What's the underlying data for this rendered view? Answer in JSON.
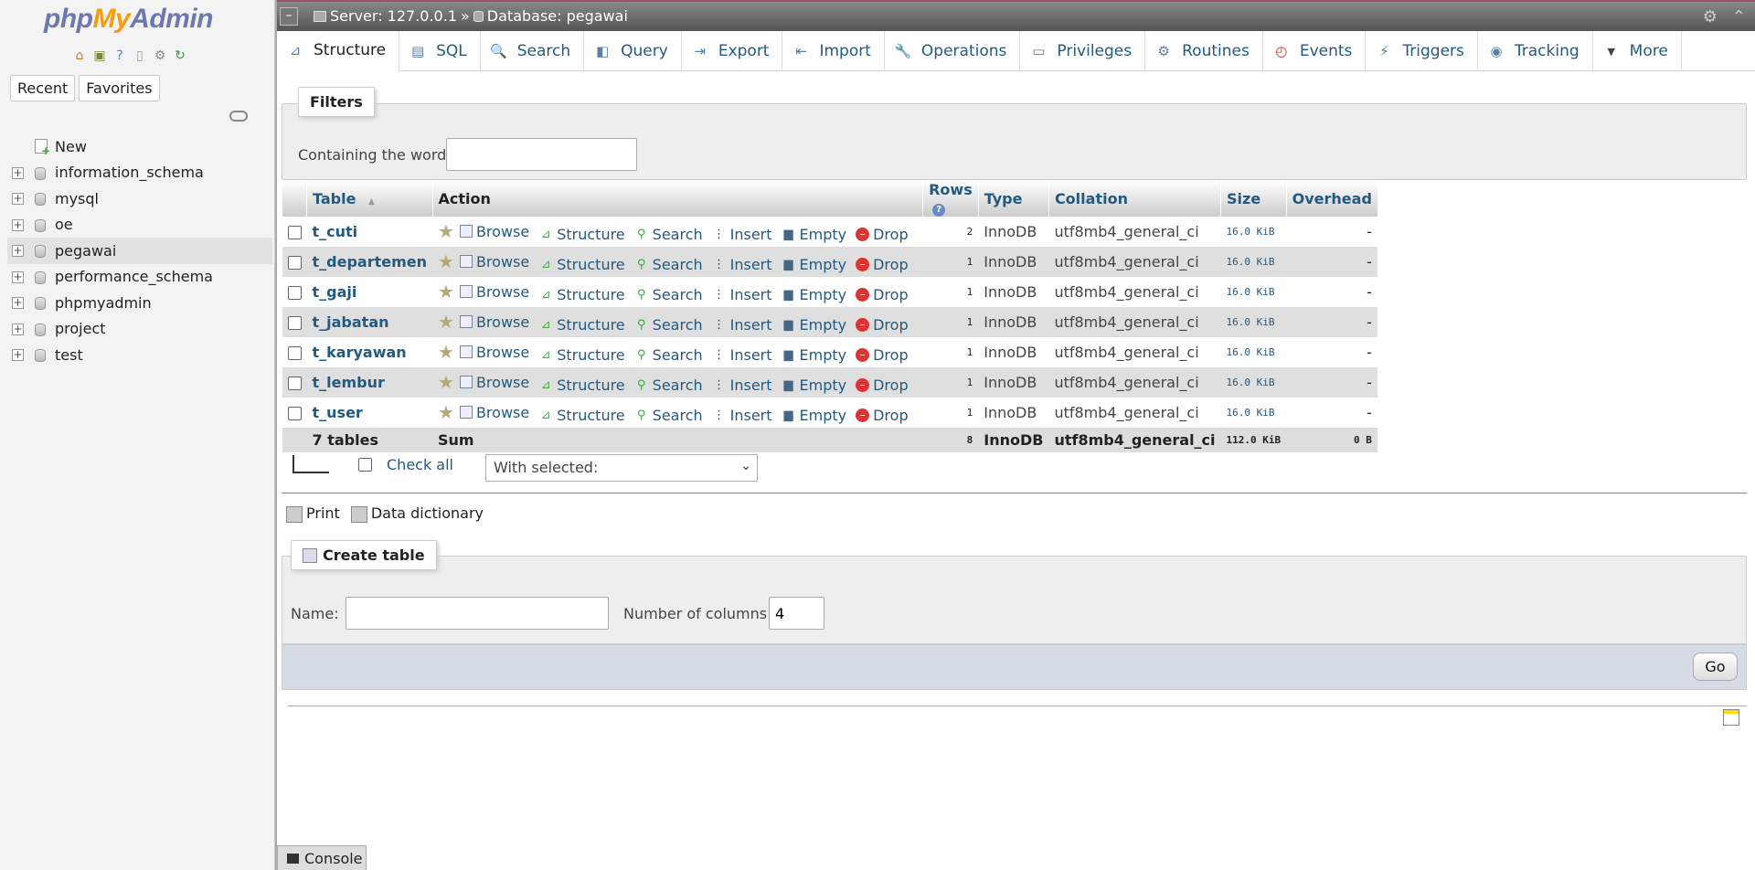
{
  "app": {
    "logo": {
      "part1": "php",
      "part2": "My",
      "part3": "Admin"
    },
    "recent_label": "Recent",
    "favorites_label": "Favorites"
  },
  "tree": {
    "new_label": "New",
    "databases": [
      {
        "name": "information_schema",
        "active": false
      },
      {
        "name": "mysql",
        "active": false
      },
      {
        "name": "oe",
        "active": false
      },
      {
        "name": "pegawai",
        "active": true
      },
      {
        "name": "performance_schema",
        "active": false
      },
      {
        "name": "phpmyadmin",
        "active": false
      },
      {
        "name": "project",
        "active": false
      },
      {
        "name": "test",
        "active": false
      }
    ]
  },
  "breadcrumb": {
    "server": "Server: 127.0.0.1",
    "separator": "»",
    "database": "Database: pegawai"
  },
  "menu": {
    "tabs": [
      {
        "label": "Structure",
        "icon": "structure-icon",
        "glyph": "⊿"
      },
      {
        "label": "SQL",
        "icon": "sql-icon",
        "glyph": "▤"
      },
      {
        "label": "Search",
        "icon": "search-icon",
        "glyph": "🔍"
      },
      {
        "label": "Query",
        "icon": "query-icon",
        "glyph": "◧"
      },
      {
        "label": "Export",
        "icon": "export-icon",
        "glyph": "⇥"
      },
      {
        "label": "Import",
        "icon": "import-icon",
        "glyph": "⇤"
      },
      {
        "label": "Operations",
        "icon": "wrench-icon",
        "glyph": "🔧"
      },
      {
        "label": "Privileges",
        "icon": "privileges-icon",
        "glyph": "▭"
      },
      {
        "label": "Routines",
        "icon": "routines-icon",
        "glyph": "⚙"
      },
      {
        "label": "Events",
        "icon": "clock-icon",
        "glyph": "◴"
      },
      {
        "label": "Triggers",
        "icon": "triggers-icon",
        "glyph": "⚡"
      },
      {
        "label": "Tracking",
        "icon": "eye-icon",
        "glyph": "◉"
      },
      {
        "label": "More",
        "icon": "caret-down-icon",
        "glyph": "▼"
      }
    ]
  },
  "filters": {
    "legend": "Filters",
    "label": "Containing the word:",
    "value": ""
  },
  "table": {
    "headers": {
      "table": "Table",
      "sort_indicator": "▲",
      "action": "Action",
      "rows": "Rows",
      "type": "Type",
      "collation": "Collation",
      "size": "Size",
      "overhead": "Overhead"
    },
    "actions": {
      "browse": "Browse",
      "structure": "Structure",
      "search": "Search",
      "insert": "Insert",
      "empty": "Empty",
      "drop": "Drop"
    },
    "rows": [
      {
        "name": "t_cuti",
        "rows": "2",
        "type": "InnoDB",
        "collation": "utf8mb4_general_ci",
        "size": "16.0 KiB",
        "overhead": "-"
      },
      {
        "name": "t_departemen",
        "rows": "1",
        "type": "InnoDB",
        "collation": "utf8mb4_general_ci",
        "size": "16.0 KiB",
        "overhead": "-"
      },
      {
        "name": "t_gaji",
        "rows": "1",
        "type": "InnoDB",
        "collation": "utf8mb4_general_ci",
        "size": "16.0 KiB",
        "overhead": "-"
      },
      {
        "name": "t_jabatan",
        "rows": "1",
        "type": "InnoDB",
        "collation": "utf8mb4_general_ci",
        "size": "16.0 KiB",
        "overhead": "-"
      },
      {
        "name": "t_karyawan",
        "rows": "1",
        "type": "InnoDB",
        "collation": "utf8mb4_general_ci",
        "size": "16.0 KiB",
        "overhead": "-"
      },
      {
        "name": "t_lembur",
        "rows": "1",
        "type": "InnoDB",
        "collation": "utf8mb4_general_ci",
        "size": "16.0 KiB",
        "overhead": "-"
      },
      {
        "name": "t_user",
        "rows": "1",
        "type": "InnoDB",
        "collation": "utf8mb4_general_ci",
        "size": "16.0 KiB",
        "overhead": "-"
      }
    ],
    "summary": {
      "count": "7 tables",
      "sum_label": "Sum",
      "rows": "8",
      "type": "InnoDB",
      "collation": "utf8mb4_general_ci",
      "size": "112.0 KiB",
      "overhead": "0 B"
    }
  },
  "bulk": {
    "check_all": "Check all",
    "with_selected": "With selected:"
  },
  "links": {
    "print": "Print",
    "data_dictionary": "Data dictionary"
  },
  "create_table": {
    "legend": "Create table",
    "name_label": "Name:",
    "name_value": "",
    "columns_label": "Number of columns:",
    "columns_value": "4",
    "go_label": "Go"
  },
  "console": {
    "label": "Console"
  }
}
